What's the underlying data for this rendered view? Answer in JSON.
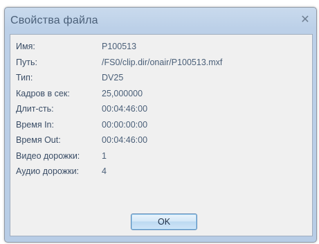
{
  "window": {
    "title": "Свойства файла",
    "close_icon": "close-icon"
  },
  "properties": [
    {
      "label": "Имя:",
      "value": "P100513"
    },
    {
      "label": "Путь:",
      "value": "/FS0/clip.dir/onair/P100513.mxf"
    },
    {
      "label": "Тип:",
      "value": "DV25"
    },
    {
      "label": "Кадров в сек:",
      "value": "25,000000"
    },
    {
      "label": "Длит-сть:",
      "value": "00:04:46:00"
    },
    {
      "label": "Время In:",
      "value": "00:00:00:00"
    },
    {
      "label": "Время Out:",
      "value": "00:04:46:00"
    },
    {
      "label": "Видео дорожки:",
      "value": "1"
    },
    {
      "label": "Аудио дорожки:",
      "value": "4"
    }
  ],
  "buttons": {
    "ok_label": "OK"
  },
  "colors": {
    "frame": "#bcd0e8",
    "panel": "#f0f0f0",
    "text": "#3a4d66"
  }
}
